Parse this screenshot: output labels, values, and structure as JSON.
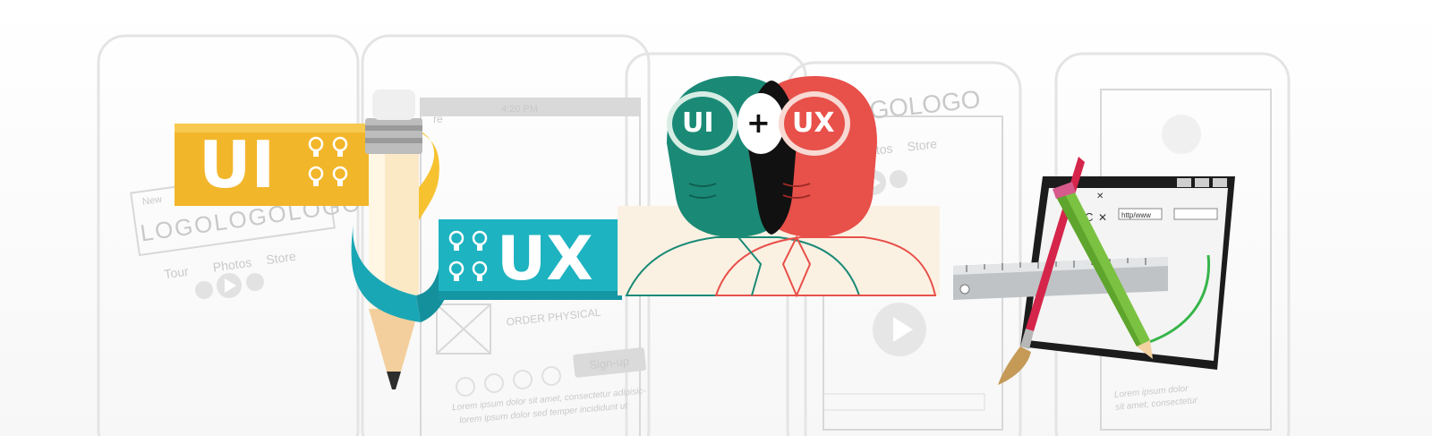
{
  "background": {
    "logo_left": "LOGOLOGOLOGO",
    "logo_right": "LOGOLOGO",
    "nav_left": [
      "Tour",
      "Photos",
      "Store"
    ],
    "nav_right": [
      "Photos",
      "Store"
    ],
    "time": "4:20 PM",
    "store_prefix": "re",
    "order_label": "ORDER PHYSICAL",
    "signup_label": "Sign-up",
    "lorem_1": "Lorem ipsum dolor sit amet, consectetur adipisic-",
    "lorem_2": "lorem ipsum dolor sed temper incididunt ut",
    "lorem_3": "Lorem ipsum dolor",
    "lorem_4": "sit amet, consectetur",
    "new_label": "New",
    "rs_label": "RS"
  },
  "ribbons": {
    "ui": "UI",
    "ux": "UX",
    "colors": {
      "ui": "#f0b52a",
      "ux": "#1eb3c1"
    }
  },
  "heads": {
    "left_brain": "UI",
    "plus": "+",
    "right_brain": "UX",
    "colors": {
      "teal": "#1a8a76",
      "red": "#e8504a"
    }
  },
  "tools": {
    "url_text": "http/www",
    "close_glyph": "✕",
    "x_glyph": "✕",
    "c_glyph": "C"
  }
}
